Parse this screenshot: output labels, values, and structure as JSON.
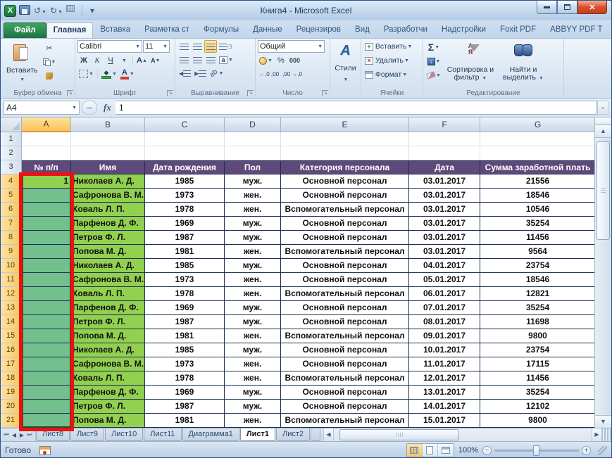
{
  "window": {
    "title": "Книга4  -  Microsoft Excel"
  },
  "ribbon_tabs": {
    "items": [
      {
        "label": "Файл",
        "file": true,
        "active": false
      },
      {
        "label": "Главная",
        "file": false,
        "active": true
      },
      {
        "label": "Вставка",
        "file": false,
        "active": false
      },
      {
        "label": "Разметка ст",
        "file": false,
        "active": false
      },
      {
        "label": "Формулы",
        "file": false,
        "active": false
      },
      {
        "label": "Данные",
        "file": false,
        "active": false
      },
      {
        "label": "Рецензиров",
        "file": false,
        "active": false
      },
      {
        "label": "Вид",
        "file": false,
        "active": false
      },
      {
        "label": "Разработчи",
        "file": false,
        "active": false
      },
      {
        "label": "Надстройки",
        "file": false,
        "active": false
      },
      {
        "label": "Foxit PDF",
        "file": false,
        "active": false
      },
      {
        "label": "ABBYY PDF T",
        "file": false,
        "active": false
      }
    ]
  },
  "ribbon": {
    "clipboard": {
      "paste": "Вставить",
      "group_label": "Буфер обмена"
    },
    "font": {
      "name": "Calibri",
      "size": "11",
      "bold": "Ж",
      "italic": "К",
      "underline": "Ч",
      "grow": "А",
      "shrink": "А",
      "color_a": "А",
      "group_label": "Шрифт"
    },
    "alignment": {
      "group_label": "Выравнивание"
    },
    "number": {
      "format": "Общий",
      "percent": "%",
      "thousands": "000",
      "inc_dec": ",00",
      "dec_dec": ",00",
      "group_label": "Число"
    },
    "styles": {
      "label": "Стили"
    },
    "cells": {
      "insert": "Вставить",
      "delete": "Удалить",
      "format": "Формат",
      "group_label": "Ячейки"
    },
    "editing": {
      "sigma": "Σ",
      "sort_glyph_top": "А",
      "sort_glyph_bottom": "Я",
      "sort": "Сортировка и фильтр",
      "find": "Найти и выделить",
      "group_label": "Редактирование"
    }
  },
  "formula_bar": {
    "name_box": "A4",
    "fx": "fx",
    "value": "1"
  },
  "grid": {
    "columns": [
      "A",
      "B",
      "C",
      "D",
      "E",
      "F",
      "G"
    ],
    "selected_column": "A",
    "empty_row_numbers": [
      1,
      2
    ],
    "header_row_number": 3,
    "headers": [
      "№ п/п",
      "Имя",
      "Дата рождения",
      "Пол",
      "Категория персонала",
      "Дата",
      "Сумма заработной плать"
    ],
    "rows": [
      {
        "num": 4,
        "a": "1",
        "name": "Николаев А. Д.",
        "year": "1985",
        "gender": "муж.",
        "category": "Основной персонал",
        "date": "03.01.2017",
        "sum": "21556"
      },
      {
        "num": 5,
        "a": "",
        "name": "Сафронова В. М.",
        "year": "1973",
        "gender": "жен.",
        "category": "Основной персонал",
        "date": "03.01.2017",
        "sum": "18546"
      },
      {
        "num": 6,
        "a": "",
        "name": "Коваль Л. П.",
        "year": "1978",
        "gender": "жен.",
        "category": "Вспомогательный персонал",
        "date": "03.01.2017",
        "sum": "10546"
      },
      {
        "num": 7,
        "a": "",
        "name": "Парфенов Д. Ф.",
        "year": "1969",
        "gender": "муж.",
        "category": "Основной персонал",
        "date": "03.01.2017",
        "sum": "35254"
      },
      {
        "num": 8,
        "a": "",
        "name": "Петров Ф. Л.",
        "year": "1987",
        "gender": "муж.",
        "category": "Основной персонал",
        "date": "03.01.2017",
        "sum": "11456"
      },
      {
        "num": 9,
        "a": "",
        "name": "Попова М. Д.",
        "year": "1981",
        "gender": "жен.",
        "category": "Вспомогательный персонал",
        "date": "03.01.2017",
        "sum": "9564"
      },
      {
        "num": 10,
        "a": "",
        "name": "Николаев А. Д.",
        "year": "1985",
        "gender": "муж.",
        "category": "Основной персонал",
        "date": "04.01.2017",
        "sum": "23754"
      },
      {
        "num": 11,
        "a": "",
        "name": "Сафронова В. М.",
        "year": "1973",
        "gender": "жен.",
        "category": "Основной персонал",
        "date": "05.01.2017",
        "sum": "18546"
      },
      {
        "num": 12,
        "a": "",
        "name": "Коваль Л. П.",
        "year": "1978",
        "gender": "жен.",
        "category": "Вспомогательный персонал",
        "date": "06.01.2017",
        "sum": "12821"
      },
      {
        "num": 13,
        "a": "",
        "name": "Парфенов Д. Ф.",
        "year": "1969",
        "gender": "муж.",
        "category": "Основной персонал",
        "date": "07.01.2017",
        "sum": "35254"
      },
      {
        "num": 14,
        "a": "",
        "name": "Петров Ф. Л.",
        "year": "1987",
        "gender": "муж.",
        "category": "Основной персонал",
        "date": "08.01.2017",
        "sum": "11698"
      },
      {
        "num": 15,
        "a": "",
        "name": "Попова М. Д.",
        "year": "1981",
        "gender": "жен.",
        "category": "Вспомогательный персонал",
        "date": "09.01.2017",
        "sum": "9800"
      },
      {
        "num": 16,
        "a": "",
        "name": "Николаев А. Д.",
        "year": "1985",
        "gender": "муж.",
        "category": "Основной персонал",
        "date": "10.01.2017",
        "sum": "23754"
      },
      {
        "num": 17,
        "a": "",
        "name": "Сафронова В. М.",
        "year": "1973",
        "gender": "жен.",
        "category": "Основной персонал",
        "date": "11.01.2017",
        "sum": "17115"
      },
      {
        "num": 18,
        "a": "",
        "name": "Коваль Л. П.",
        "year": "1978",
        "gender": "жен.",
        "category": "Вспомогательный персонал",
        "date": "12.01.2017",
        "sum": "11456"
      },
      {
        "num": 19,
        "a": "",
        "name": "Парфенов Д. Ф.",
        "year": "1969",
        "gender": "муж.",
        "category": "Основной персонал",
        "date": "13.01.2017",
        "sum": "35254"
      },
      {
        "num": 20,
        "a": "",
        "name": "Петров Ф. Л.",
        "year": "1987",
        "gender": "муж.",
        "category": "Основной персонал",
        "date": "14.01.2017",
        "sum": "12102"
      },
      {
        "num": 21,
        "a": "",
        "name": "Попова М. Д.",
        "year": "1981",
        "gender": "жен.",
        "category": "Вспомогательный персонал",
        "date": "15.01.2017",
        "sum": "9800"
      }
    ]
  },
  "sheet_tabs": {
    "tabs": [
      "Лист8",
      "Лист9",
      "Лист10",
      "Лист11",
      "Диаграмма1",
      "Лист1",
      "Лист2"
    ],
    "active": "Лист1"
  },
  "status_bar": {
    "ready": "Готово",
    "zoom": "100%"
  },
  "colors": {
    "header_purple": "#5F497A",
    "cell_green": "#92D050",
    "selection_green": "#74BF8E",
    "annotation_red": "#EE1111",
    "selected_header_orange": "#F9C55E",
    "table_border": "#1a2f52"
  }
}
